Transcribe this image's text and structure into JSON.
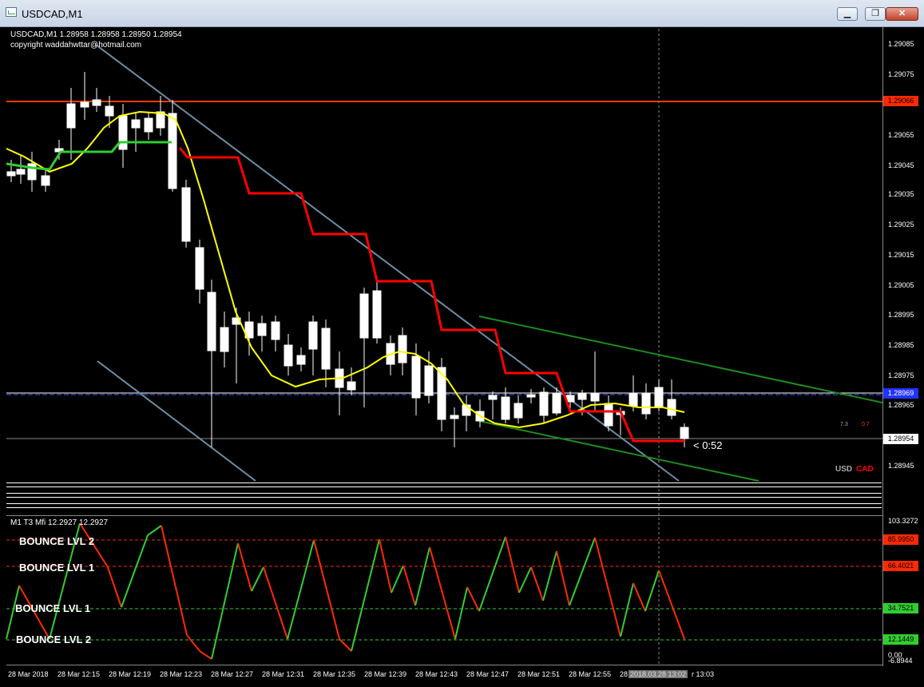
{
  "window": {
    "title": "USDCAD,M1",
    "buttons": {
      "minimize": "▁",
      "restore": "❐",
      "close": "✕"
    }
  },
  "chart_header": {
    "line1": "USDCAD,M1  1.28958 1.28958 1.28950 1.28954",
    "line2": "copyright waddahwttar@hotmail.com"
  },
  "indicator_header": "M1  T3 Mfi  12.2927 12.2927",
  "countdown": "< 0:52",
  "small_values": {
    "a": "7.3",
    "b": "0.7"
  },
  "currency_labels": {
    "usd": "USD",
    "cad": "CAD"
  },
  "bounce_levels": {
    "upper2": "BOUNCE LVL 2",
    "upper1": "BOUNCE LVL 1",
    "lower1": "BOUNCE LVL 1",
    "lower2": "BOUNCE LVL 2"
  },
  "price_axis": [
    "1.29085",
    "1.29075",
    "1.29055",
    "1.29045",
    "1.29035",
    "1.29025",
    "1.29015",
    "1.29005",
    "1.28995",
    "1.28985",
    "1.28975",
    "1.28965",
    "1.28945"
  ],
  "price_tags": {
    "red_line": "1.29066",
    "blue_line": "1.28969",
    "current": "1.28954"
  },
  "indicator_axis": {
    "top": "103.3272",
    "lvl2_up": "85.9950",
    "lvl1_up": "66.4021",
    "lvl1_down": "34.7521",
    "lvl2_down": "12.1449",
    "zero": "0.00",
    "bottom": "-6.8944"
  },
  "time_axis": [
    "28 Mar 2018",
    "28 Mar 12:15",
    "28 Mar 12:19",
    "28 Mar 12:23",
    "28 Mar 12:27",
    "28 Mar 12:31",
    "28 Mar 12:35",
    "28 Mar 12:39",
    "28 Mar 12:43",
    "28 Mar 12:47",
    "28 Mar 12:51",
    "28 Mar 12:55",
    "28"
  ],
  "crosshair_time": "2018.03.28 13:02",
  "crosshair_time_tail": "r 13:03",
  "colors": {
    "bull": "#00c800",
    "bear": "#ffffff",
    "ma_yellow": "#ffff00",
    "ma_green": "#32cd32",
    "stop_red": "#ff0000",
    "hline_red": "#ff3c00",
    "hline_blue": "#4060ff",
    "trend": "#6c8ea3",
    "channel": "#1f8a1f",
    "mfi_up": "#32cd32",
    "mfi_down": "#ff2a00"
  }
}
